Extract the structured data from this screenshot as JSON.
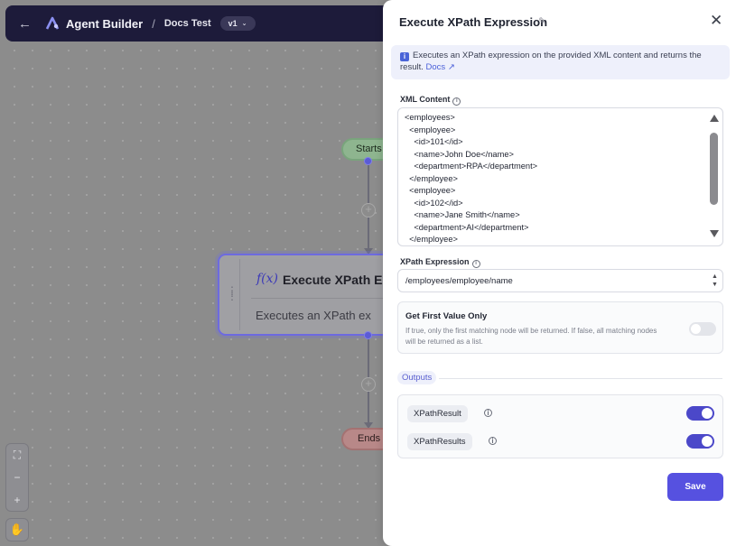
{
  "topbar": {
    "brand": "Agent Builder",
    "separator": "/",
    "project": "Docs Test",
    "version": "v1"
  },
  "canvas": {
    "start_label": "Starts",
    "end_label": "Ends",
    "node": {
      "icon": "f(x)",
      "title": "Execute XPath Ex",
      "description": "Executes an XPath ex"
    }
  },
  "panel": {
    "title": "Execute XPath Expression",
    "info_text": "Executes an XPath expression on the provided XML content and returns the result.",
    "docs_link": "Docs",
    "xml_label": "XML Content",
    "xml_lines": [
      "<employees>",
      "  <employee>",
      "    <id>101</id>",
      "    <name>John Doe</name>",
      "    <department>RPA</department>",
      "  </employee>",
      "  <employee>",
      "    <id>102</id>",
      "    <name>Jane Smith</name>",
      "    <department>AI</department>",
      "  </employee>"
    ],
    "xpath_label": "XPath Expression",
    "xpath_value": "/employees/employee/name",
    "first_value": {
      "title": "Get First Value Only",
      "description": "If true, only the first matching node will be returned. If false, all matching nodes will be returned as a list.",
      "enabled": false
    },
    "outputs_label": "Outputs",
    "outputs": [
      {
        "name": "XPathResult",
        "enabled": true
      },
      {
        "name": "XPathResults",
        "enabled": true
      }
    ],
    "save_label": "Save"
  },
  "colors": {
    "accent": "#5651e0",
    "topbar_bg": "#1d1b3a",
    "start_pill": "#8eb58f",
    "end_pill": "#b88888"
  }
}
